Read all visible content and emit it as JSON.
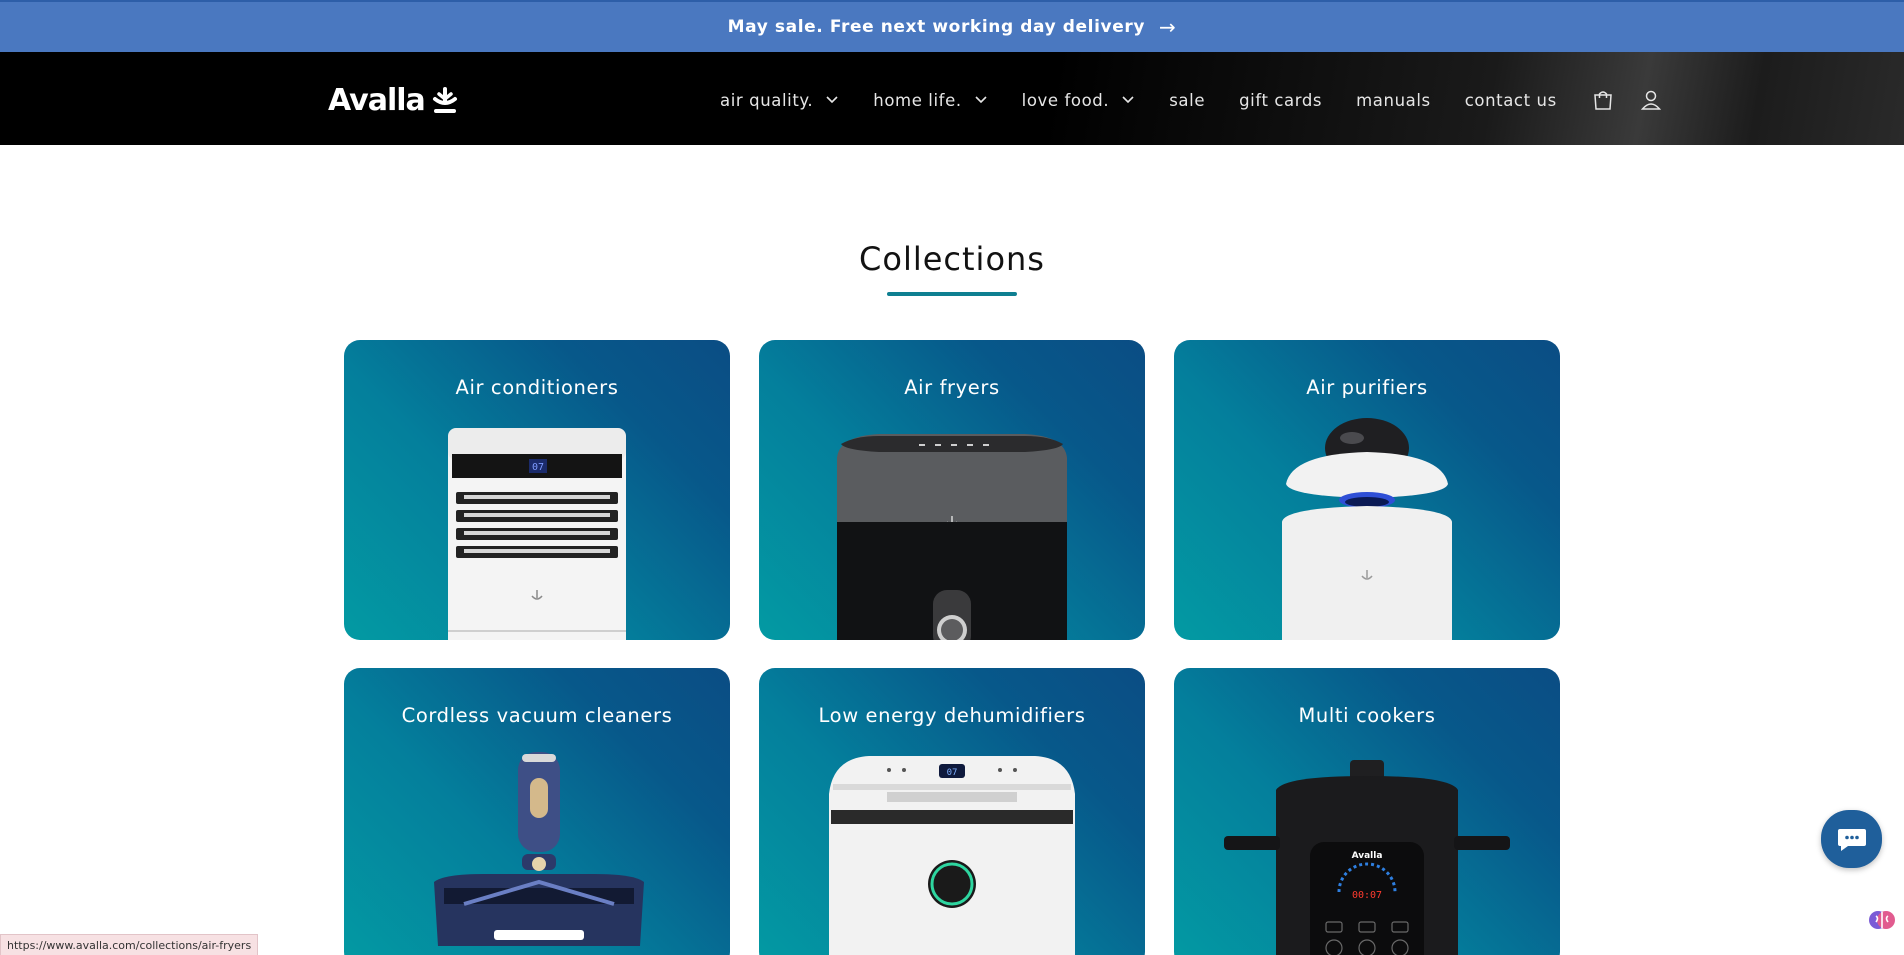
{
  "announcement": {
    "text": "May sale. Free next working day delivery",
    "arrow": "→"
  },
  "header": {
    "logo_text": "Avalla",
    "nav": [
      {
        "label": "air quality.",
        "has_dropdown": true
      },
      {
        "label": "home life.",
        "has_dropdown": true
      },
      {
        "label": "love food.",
        "has_dropdown": true
      },
      {
        "label": "sale",
        "has_dropdown": false
      },
      {
        "label": "gift cards",
        "has_dropdown": false
      },
      {
        "label": "manuals",
        "has_dropdown": false
      },
      {
        "label": "contact us",
        "has_dropdown": false
      }
    ],
    "icons": [
      "cart-icon",
      "account-icon"
    ]
  },
  "page": {
    "title": "Collections"
  },
  "collections": [
    {
      "title": "Air conditioners",
      "display": "07"
    },
    {
      "title": "Air fryers"
    },
    {
      "title": "Air purifiers"
    },
    {
      "title": "Cordless vacuum cleaners"
    },
    {
      "title": "Low energy dehumidifiers",
      "display": "07"
    },
    {
      "title": "Multi cookers",
      "brand": "Avalla",
      "display": "00:07"
    }
  ],
  "status_bar": {
    "url": "https://www.avalla.com/collections/air-fryers"
  },
  "colors": {
    "announcement_bg": "#4a78c0",
    "accent": "#0e7f91",
    "card_teal": "#039aa3",
    "card_blue": "#0b4d84",
    "chat_button": "#1f5f9b"
  }
}
